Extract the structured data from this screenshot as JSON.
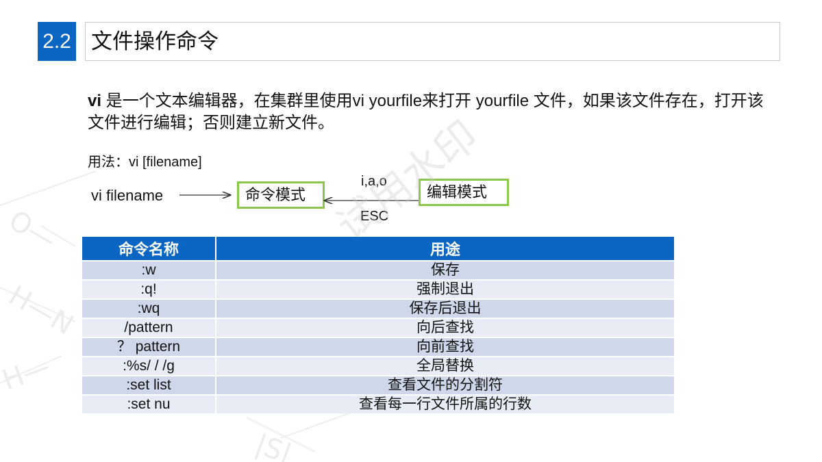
{
  "header": {
    "section_number": "2.2",
    "title": "文件操作命令"
  },
  "intro": {
    "bold_lead": "vi",
    "text": " 是一个文本编辑器，在集群里使用vi yourfile来打开 yourfile 文件，如果该文件存在，打开该文件进行编辑；否则建立新文件。"
  },
  "usage": "用法：vi [filename]",
  "diagram": {
    "start_label": "vi filename",
    "command_mode": "命令模式",
    "edit_mode": "编辑模式",
    "to_edit_label": "i,a,o",
    "to_command_label": "ESC",
    "box_color": "#8ac64a"
  },
  "table": {
    "headers": [
      "命令名称",
      "用途"
    ],
    "rows": [
      [
        ":w",
        "保存"
      ],
      [
        ":q!",
        "强制退出"
      ],
      [
        ":wq",
        "保存后退出"
      ],
      [
        "/pattern",
        "向后查找"
      ],
      [
        "？ pattern",
        "向前查找"
      ],
      [
        ":%s/ / /g",
        "全局替换"
      ],
      [
        ":set list",
        "查看文件的分割符"
      ],
      [
        ":set nu",
        "查看每一行文件所属的行数"
      ]
    ],
    "header_color": "#0a66c2"
  },
  "watermark": "试用水印"
}
